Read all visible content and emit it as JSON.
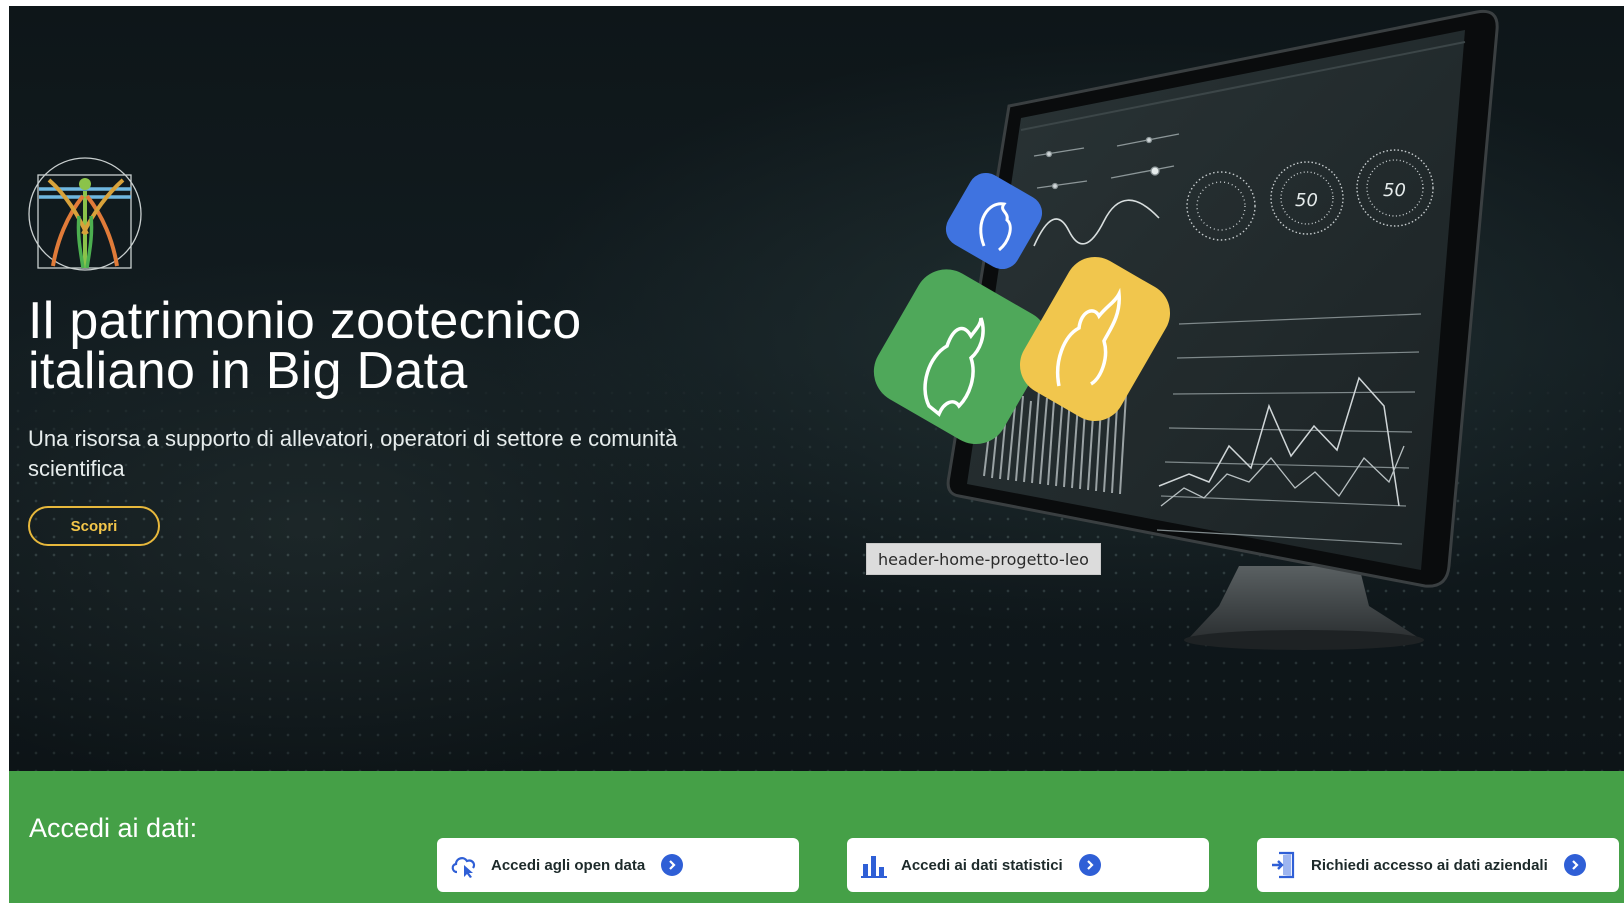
{
  "hero": {
    "title_line1": "Il patrimonio zootecnico",
    "title_line2": "italiano in Big Data",
    "subtitle": "Una risorsa a supporto di allevatori, operatori di settore e comunità scientifica",
    "cta_label": "Scopri",
    "image_tooltip": "header-home-progetto-leo",
    "dashboard_gauge_values": [
      "50",
      "50"
    ]
  },
  "data_bar": {
    "label": "Accedi ai dati:",
    "cards": [
      {
        "label": "Accedi agli open data",
        "icon": "cloud-click-icon"
      },
      {
        "label": "Accedi ai dati statistici",
        "icon": "bar-chart-icon"
      },
      {
        "label": "Richiedi accesso ai dati aziendali",
        "icon": "door-enter-icon"
      }
    ]
  },
  "colors": {
    "hero_background": "#10191c",
    "cta_border": "#e7b83c",
    "data_bar_background": "#45a047",
    "card_accent": "#2f5fd6",
    "tile_blue": "#3f73e0",
    "tile_green": "#4fa85a",
    "tile_yellow": "#f1c64d"
  }
}
